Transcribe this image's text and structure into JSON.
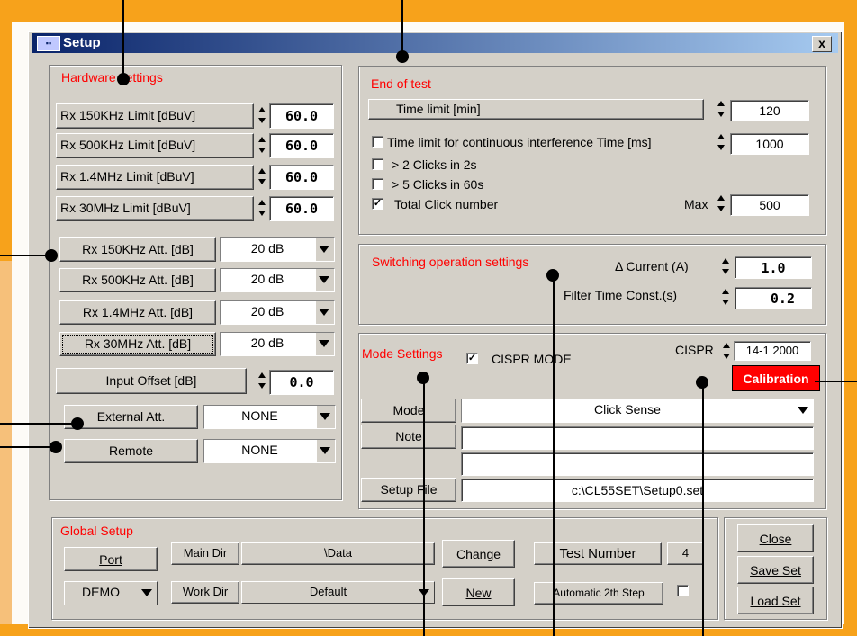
{
  "window": {
    "title": "Setup",
    "close_glyph": "x"
  },
  "hardware": {
    "title": "Hardware settings",
    "limits": [
      {
        "label": "Rx   150KHz Limit [dBuV]",
        "value": "60.0"
      },
      {
        "label": "Rx   500KHz Limit [dBuV]",
        "value": "60.0"
      },
      {
        "label": "Rx   1.4MHz Limit [dBuV]",
        "value": "60.0"
      },
      {
        "label": "Rx    30MHz Limit [dBuV]",
        "value": "60.0"
      }
    ],
    "attenuators": [
      {
        "label": "Rx 150KHz Att. [dB]",
        "value": "20 dB"
      },
      {
        "label": "Rx 500KHz Att. [dB]",
        "value": "20 dB"
      },
      {
        "label": "Rx 1.4MHz Att. [dB]",
        "value": "20 dB"
      },
      {
        "label": "Rx 30MHz Att. [dB]",
        "value": "20 dB"
      }
    ],
    "input_offset": {
      "label": "Input Offset [dB]",
      "value": "0.0"
    },
    "external_att": {
      "label": "External Att.",
      "value": "NONE"
    },
    "remote": {
      "label": "Remote",
      "value": "NONE"
    }
  },
  "end_of_test": {
    "title": "End of test",
    "time_limit": {
      "label": "Time limit [min]",
      "value": "120"
    },
    "cont_interf": {
      "label": "Time limit for continuous interference Time [ms]",
      "value": "1000",
      "checked": false
    },
    "clicks_2s": {
      "label": "> 2 Clicks in 2s",
      "checked": false
    },
    "clicks_60s": {
      "label": "> 5 Clicks in 60s",
      "checked": false
    },
    "total_click": {
      "label": "Total Click number",
      "checked": true,
      "max_label": "Max",
      "max_value": "500"
    }
  },
  "switching": {
    "title": "Switching operation settings",
    "current": {
      "label": "Δ Current (A)",
      "value": "1.0"
    },
    "filter": {
      "label": "Filter Time Const.(s)",
      "value": "0.2"
    }
  },
  "mode": {
    "title": "Mode Settings",
    "cispr_mode": {
      "label": "CISPR MODE",
      "checked": true
    },
    "cispr": {
      "label": "CISPR",
      "value": "14-1 2000"
    },
    "calibration": "Calibration",
    "mode_label": "Mode",
    "mode_value": "Click Sense",
    "note_label": "Note",
    "note_value": "",
    "note_value2": "",
    "setup_file_label": "Setup File",
    "setup_file_value": "c:\\CL55SET\\Setup0.set"
  },
  "global": {
    "title": "Global Setup",
    "port": "Port",
    "port_value": "DEMO",
    "main_dir_label": "Main Dir",
    "main_dir_value": "\\Data",
    "work_dir_label": "Work Dir",
    "work_dir_value": "Default",
    "change": "Change",
    "new": "New",
    "test_number_label": "Test Number",
    "test_number_value": "4",
    "auto_step_label": "Automatic 2th  Step",
    "auto_step_checked": false
  },
  "actions": {
    "close": "Close",
    "save": "Save Set",
    "load": "Load Set"
  },
  "colors": {
    "frame": "#f7a21b",
    "titlebar": "#0a246a",
    "accent_text": "#ff0000",
    "calibration_bg": "#ff0000"
  }
}
